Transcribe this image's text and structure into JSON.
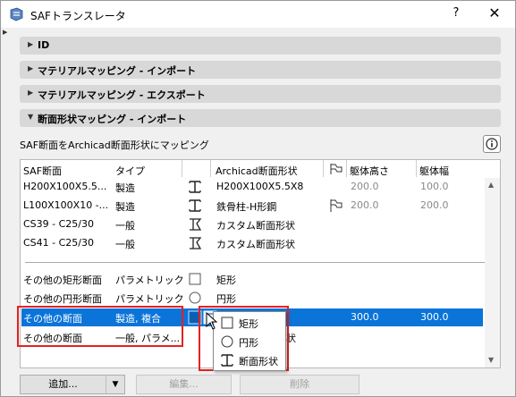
{
  "window": {
    "title": "SAFトランスレータ",
    "help_label": "?",
    "close_label": "✕",
    "corner_mark": "▶"
  },
  "sections": [
    {
      "label": "ID",
      "expanded": false
    },
    {
      "label": "マテリアルマッピング - インポート",
      "expanded": false
    },
    {
      "label": "マテリアルマッピング - エクスポート",
      "expanded": false
    },
    {
      "label": "断面形状マッピング - インポート",
      "expanded": true
    }
  ],
  "description": "SAF断面をArchicad断面形状にマッピング",
  "table": {
    "headers": {
      "saf_section": "SAF断面",
      "type": "タイプ",
      "archicad_profile": "Archicad断面形状",
      "height": "躯体高さ",
      "width": "躯体幅"
    },
    "rows": [
      {
        "saf": "H200X100X5.5...",
        "type": "製造",
        "icon": "i-beam-icon",
        "profile": "H200X100X5.5X8",
        "flag": "",
        "height": "200.0",
        "width": "100.0"
      },
      {
        "saf": "L100X100X10 -...",
        "type": "製造",
        "icon": "i-beam-icon",
        "profile": "鉄骨柱-H形鋼",
        "flag": "profile-flag-icon",
        "height": "200.0",
        "width": "200.0"
      },
      {
        "saf": "CS39 - C25/30",
        "type": "一般",
        "icon": "custom-profile-icon",
        "profile": "カスタム断面形状",
        "flag": "",
        "height": "",
        "width": ""
      },
      {
        "saf": "CS41 - C25/30",
        "type": "一般",
        "icon": "custom-profile-icon",
        "profile": "カスタム断面形状",
        "flag": "",
        "height": "",
        "width": ""
      }
    ],
    "other_rows": [
      {
        "saf": "その他の矩形断面",
        "type": "パラメトリック",
        "icon": "rectangle-icon",
        "profile": "矩形",
        "height": "",
        "width": ""
      },
      {
        "saf": "その他の円形断面",
        "type": "パラメトリック",
        "icon": "circle-icon",
        "profile": "円形",
        "height": "",
        "width": ""
      },
      {
        "saf": "その他の断面",
        "type": "製造, 複合",
        "icon": "rectangle-icon",
        "profile": "",
        "height": "300.0",
        "width": "300.0",
        "selected": true
      },
      {
        "saf": "その他の断面",
        "type": "一般, パラメ...",
        "icon": "",
        "profile": "状",
        "height": "",
        "width": ""
      }
    ]
  },
  "popup": {
    "items": [
      {
        "label": "矩形",
        "icon": "rectangle-icon"
      },
      {
        "label": "円形",
        "icon": "circle-icon"
      },
      {
        "label": "断面形状",
        "icon": "i-beam-icon"
      }
    ]
  },
  "buttons": {
    "add": "追加...",
    "add_arrow": "▼",
    "edit": "編集...",
    "delete": "削除"
  },
  "colors": {
    "selection": "#0a74d9",
    "highlight": "#e62121"
  }
}
